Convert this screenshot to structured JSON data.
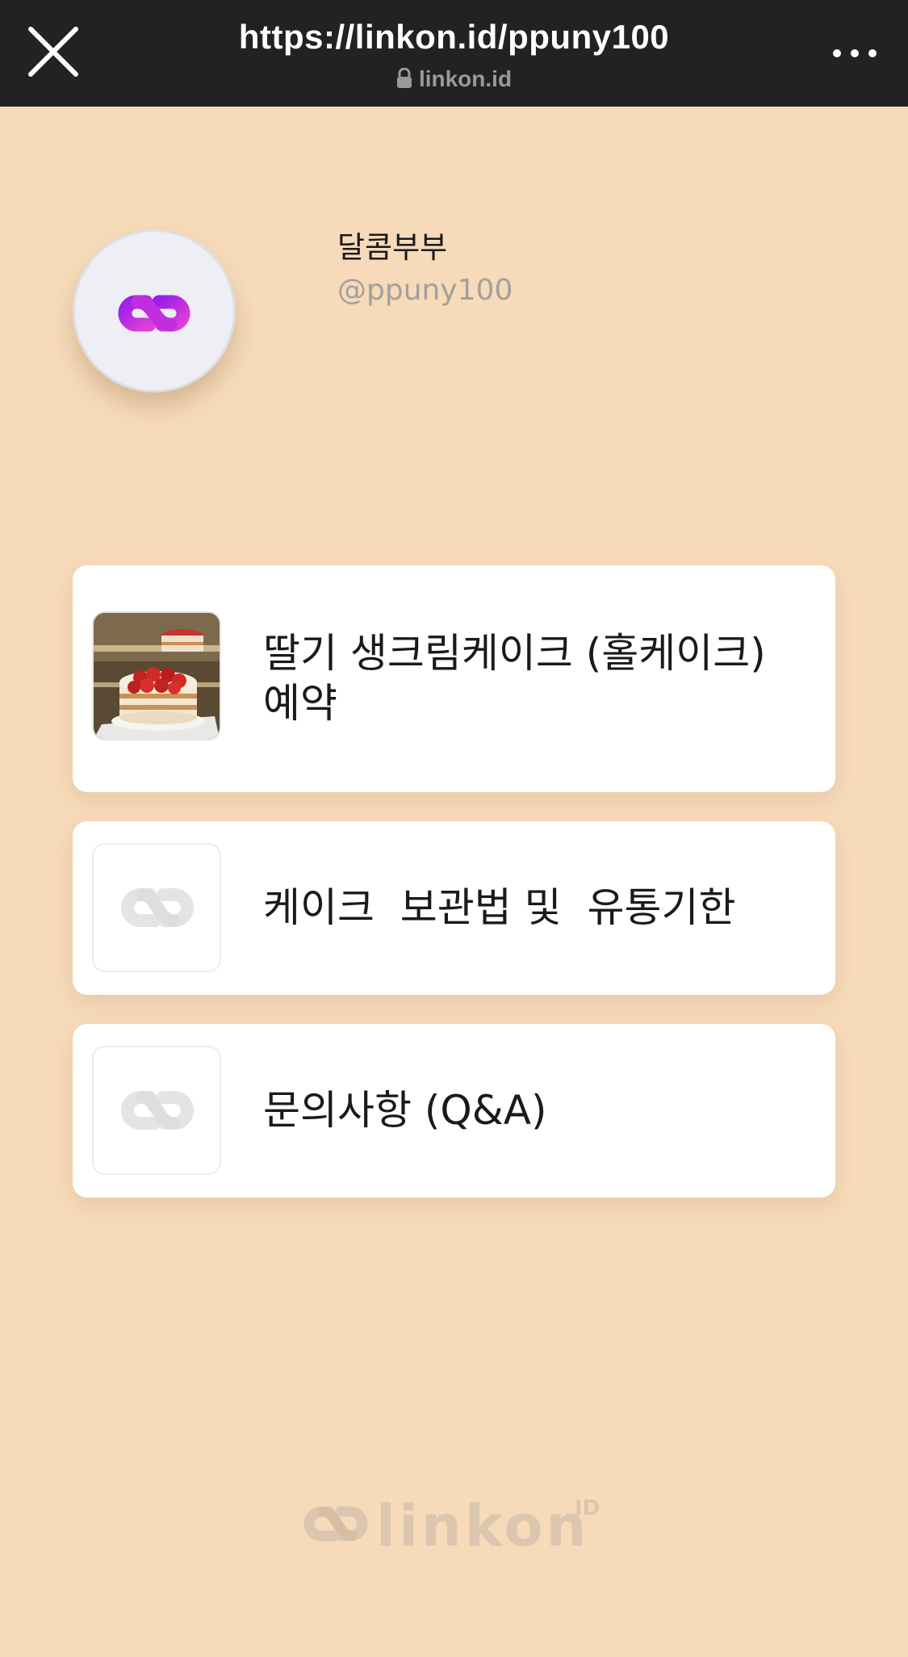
{
  "browser": {
    "url": "https://linkon.id/ppuny100",
    "domain": "linkon.id",
    "close_icon": "close-icon",
    "lock_icon": "lock-icon",
    "more_icon": "more-icon"
  },
  "profile": {
    "name": "달콤부부",
    "handle": "@ppuny100",
    "avatar_icon": "linkon-chain-icon"
  },
  "links": [
    {
      "label": "딸기 생크림케이크 (홀케이크)\n예약",
      "thumbnail": "strawberry-cake-photo"
    },
    {
      "label": "케이크  보관법 및  유통기한",
      "thumbnail": "link-placeholder-icon"
    },
    {
      "label": "문의사항 (Q&A)",
      "thumbnail": "link-placeholder-icon"
    }
  ],
  "footer": {
    "logo_text": "linkon",
    "logo_suffix": "ID"
  },
  "colors": {
    "page_background": "#f6dab9",
    "topbar_background": "#222222",
    "card_background": "#ffffff",
    "brand_gradient_start": "#9b1fe8",
    "brand_gradient_end": "#e03fd8"
  }
}
